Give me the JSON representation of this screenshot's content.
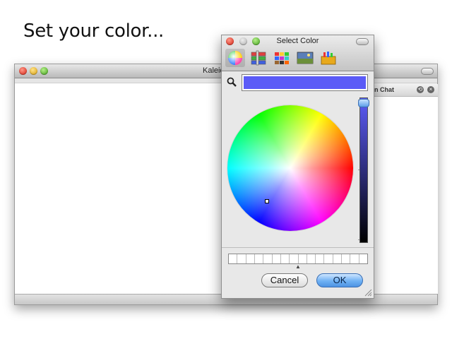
{
  "heading": "Set your color...",
  "app_window": {
    "title": "Kaleid",
    "side_panel_title": "n Chat",
    "side_buttons": [
      "restore-icon",
      "close-icon"
    ]
  },
  "color_panel": {
    "title": "Select Color",
    "modes": [
      "color-wheel-icon",
      "color-sliders-icon",
      "color-palettes-icon",
      "image-palettes-icon",
      "crayons-icon"
    ],
    "active_mode": "color-wheel-icon",
    "selected_color": "#5b5bf7",
    "brightness_percent": 97,
    "wheel_cursor": {
      "hue_deg": 235,
      "saturation": 0.64
    },
    "swatch_slots": 16,
    "cancel_label": "Cancel",
    "ok_label": "OK"
  }
}
